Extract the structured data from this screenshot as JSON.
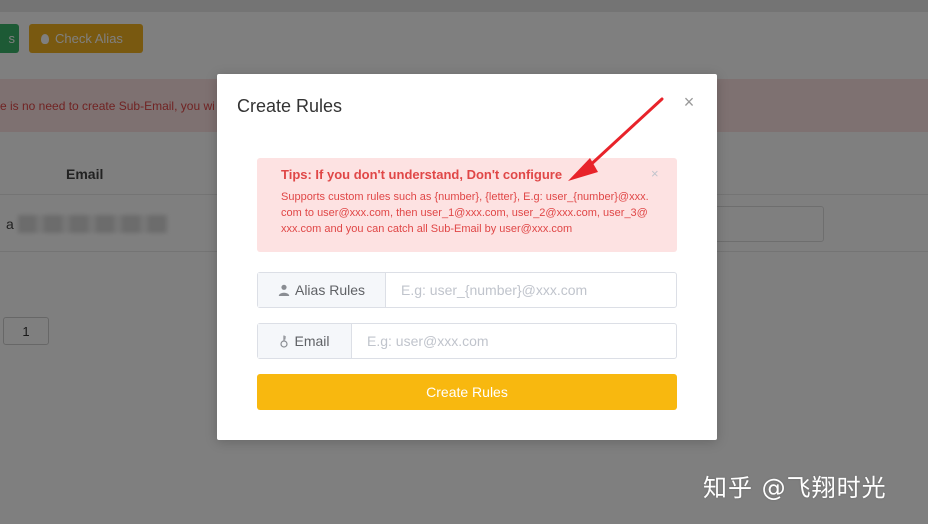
{
  "background": {
    "toolbar": {
      "check_alias_label": "Check Alias"
    },
    "notice": "re is no need to create Sub-Email, you wi",
    "table": {
      "header_email": "Email",
      "row_email_prefix": "a"
    },
    "pagination": {
      "current_page": "1"
    }
  },
  "modal": {
    "title": "Create Rules",
    "close_symbol": "×",
    "tips": {
      "title": "Tips: If you don't understand, Don't configure",
      "body": "Supports custom rules such as {number}, {letter}, E.g: user_{number}@xxx.com to user@xxx.com, then user_1@xxx.com, user_2@xxx.com, user_3@xxx.com and you can catch all Sub-Email by user@xxx.com",
      "close_symbol": "×"
    },
    "alias_rules": {
      "label": "Alias Rules",
      "placeholder": "E.g: user_{number}@xxx.com",
      "value": ""
    },
    "email": {
      "label": "Email",
      "placeholder": "E.g: user@xxx.com",
      "value": ""
    },
    "submit_label": "Create Rules"
  },
  "watermark": "知乎 @飞翔时光",
  "colors": {
    "accent_yellow": "#f8b80f",
    "tips_background": "#fde2e2",
    "tips_text": "#e04747",
    "annotation_arrow": "#e8232a",
    "overlay": "rgba(0,0,0,0.5)"
  },
  "icons": {
    "check_alias": "lightbulb-icon",
    "alias_rules": "user-icon",
    "email": "key-icon",
    "close": "close-icon"
  }
}
